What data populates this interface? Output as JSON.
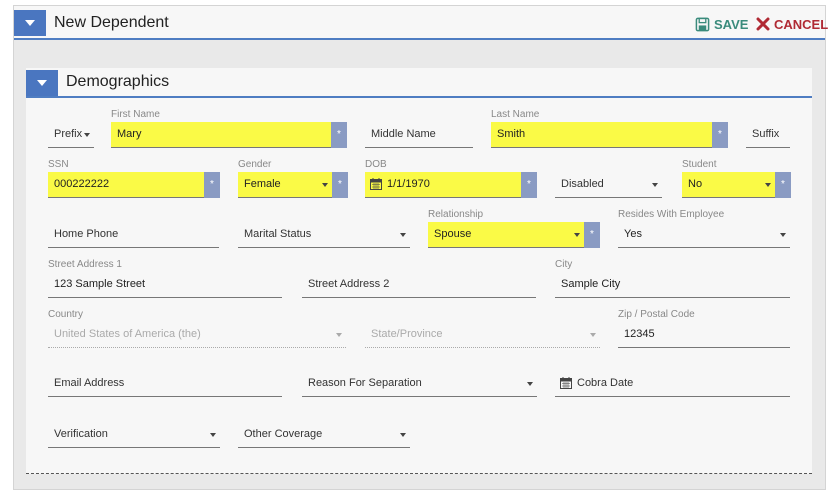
{
  "header": {
    "title": "New Dependent",
    "save_label": "SAVE",
    "cancel_label": "CANCEL"
  },
  "section": {
    "title": "Demographics"
  },
  "fields": {
    "prefix": {
      "placeholder": "Prefix"
    },
    "first_name": {
      "label": "First Name",
      "value": "Mary"
    },
    "middle_name": {
      "placeholder": "Middle Name"
    },
    "last_name": {
      "label": "Last Name",
      "value": "Smith"
    },
    "suffix": {
      "placeholder": "Suffix"
    },
    "ssn": {
      "label": "SSN",
      "value": "000222222"
    },
    "gender": {
      "label": "Gender",
      "value": "Female"
    },
    "dob": {
      "label": "DOB",
      "value": "1/1/1970"
    },
    "disabled": {
      "placeholder": "Disabled"
    },
    "student": {
      "label": "Student",
      "value": "No"
    },
    "home_phone": {
      "placeholder": "Home Phone"
    },
    "marital_status": {
      "placeholder": "Marital Status"
    },
    "relationship": {
      "label": "Relationship",
      "value": "Spouse"
    },
    "resides_with_employee": {
      "label": "Resides With Employee",
      "value": "Yes"
    },
    "street1": {
      "label": "Street Address 1",
      "value": "123 Sample Street"
    },
    "street2": {
      "placeholder": "Street Address 2"
    },
    "city": {
      "label": "City",
      "value": "Sample City"
    },
    "country": {
      "label": "Country",
      "value": "United States of America (the)"
    },
    "state": {
      "placeholder": "State/Province"
    },
    "zip": {
      "label": "Zip / Postal Code",
      "value": "12345"
    },
    "email": {
      "placeholder": "Email Address"
    },
    "reason_separation": {
      "placeholder": "Reason For Separation"
    },
    "cobra_date": {
      "placeholder": "Cobra Date"
    },
    "verification": {
      "placeholder": "Verification"
    },
    "other_coverage": {
      "placeholder": "Other Coverage"
    }
  },
  "required_mark": "*",
  "colors": {
    "accent": "#4a76c0",
    "highlight": "#fafa46",
    "save": "#3a8b7c",
    "cancel": "#b02a34",
    "required": "#8a9bc3"
  },
  "icons": {
    "toggle": "caret-down-icon",
    "save": "floppy-disk-icon",
    "cancel": "x-icon",
    "calendar": "calendar-icon",
    "dropdown": "caret-down-icon"
  }
}
